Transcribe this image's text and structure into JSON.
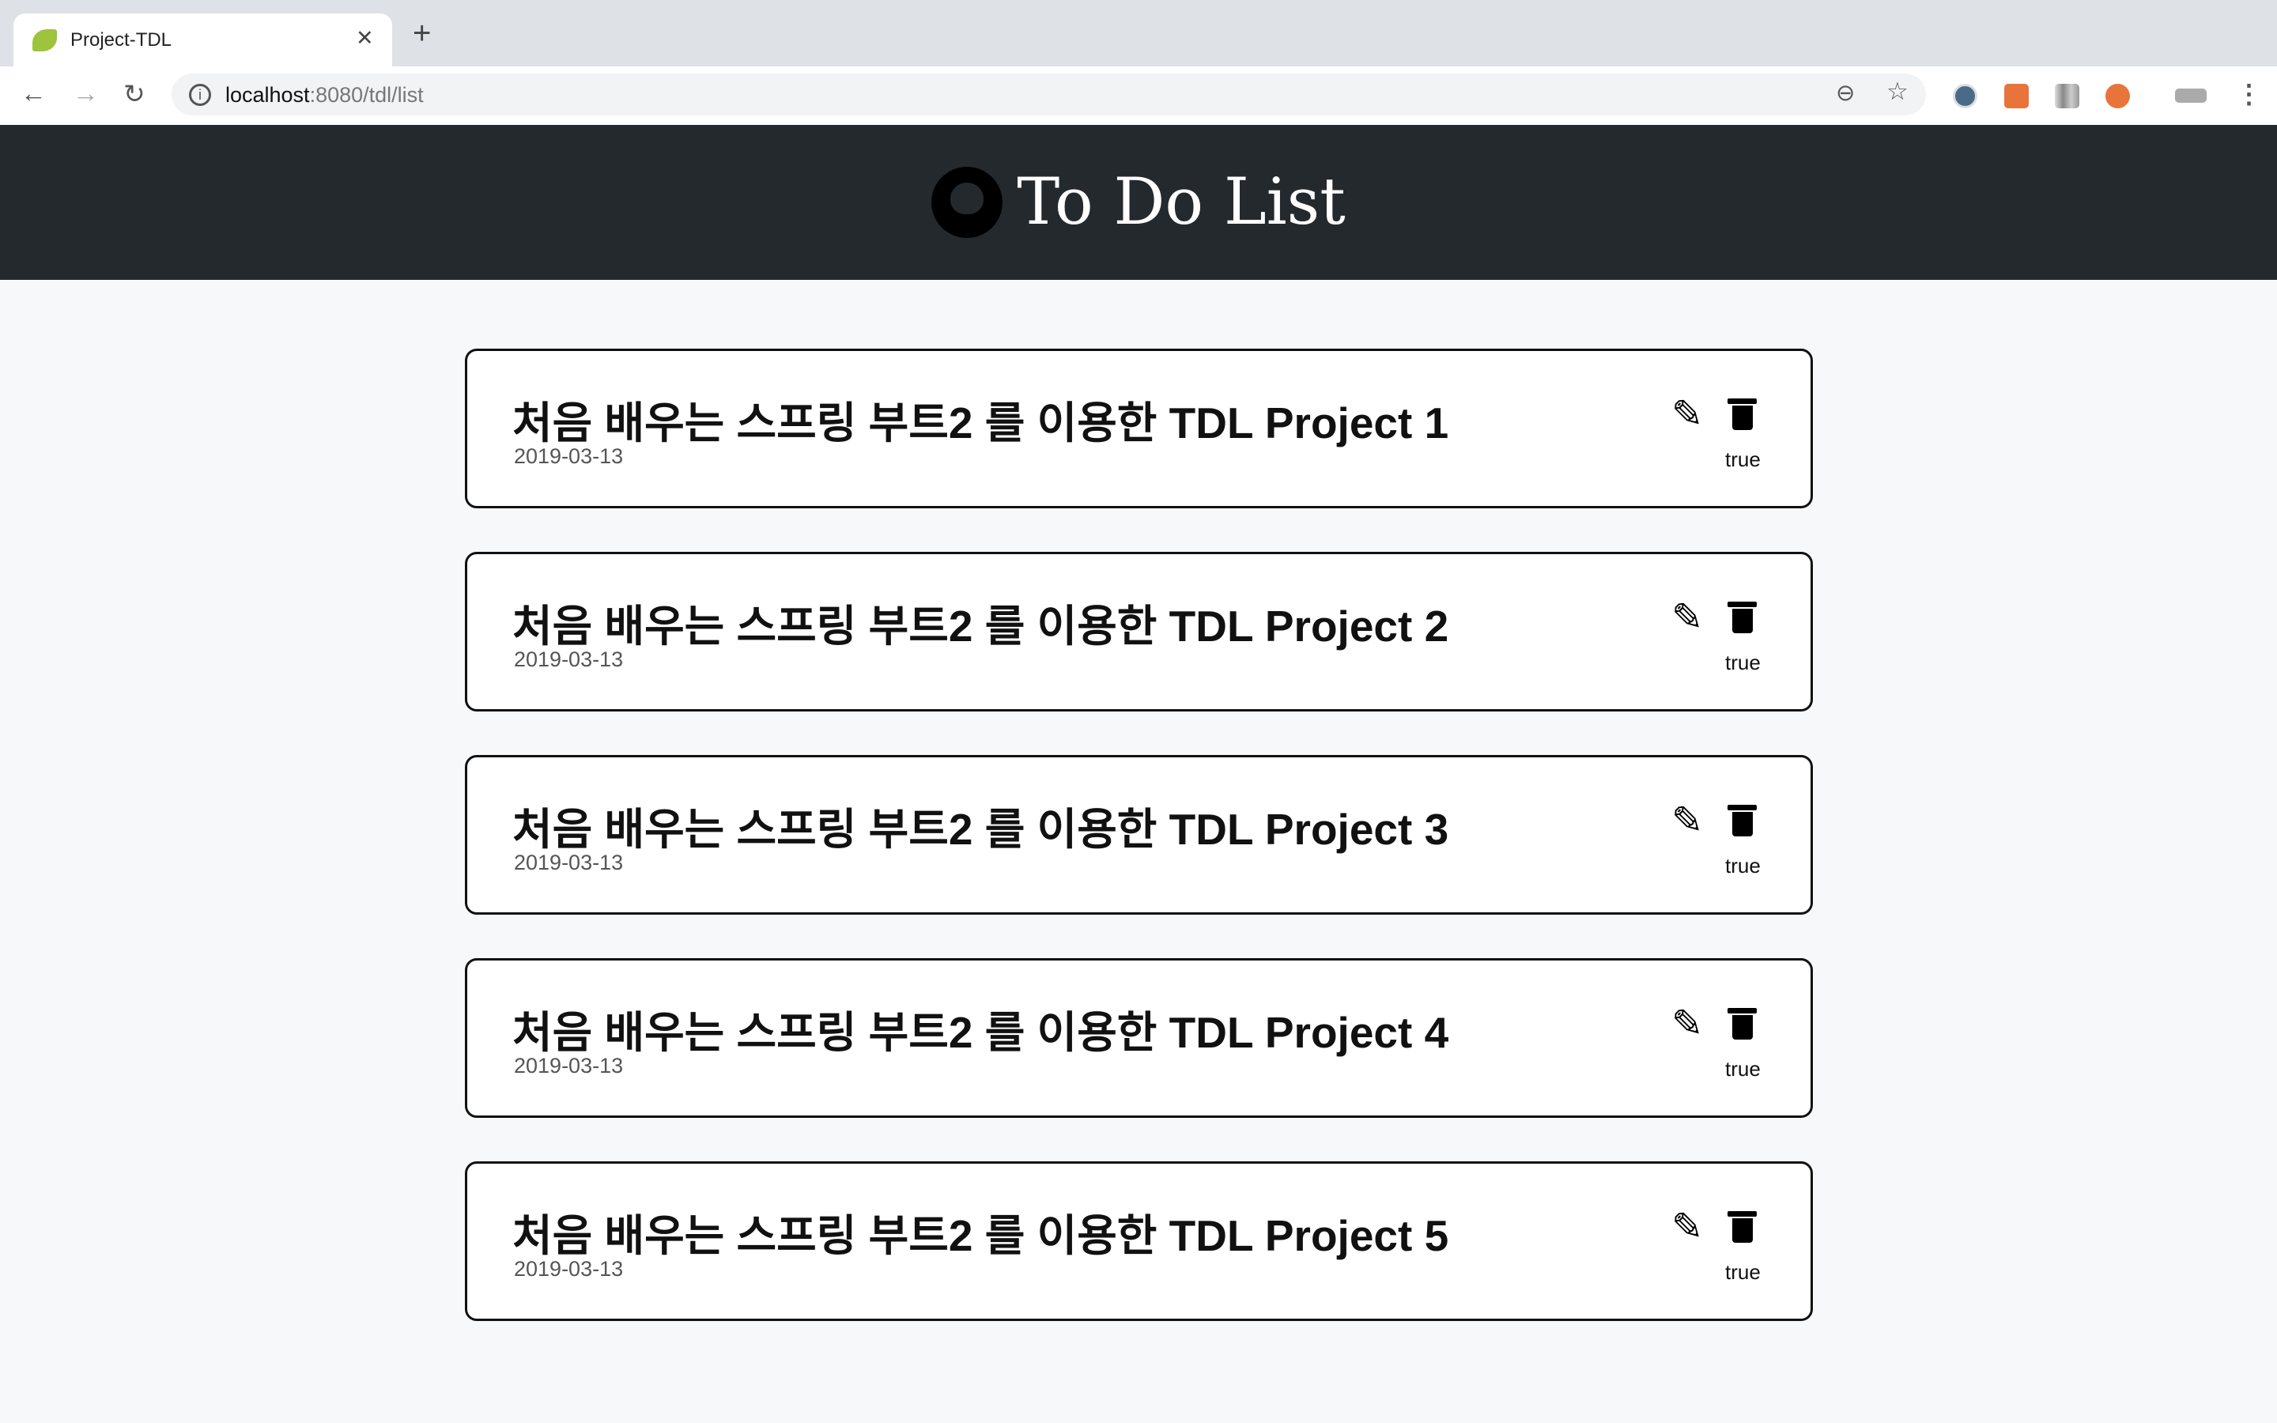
{
  "browser": {
    "tab_title": "Project-TDL",
    "url_host": "localhost",
    "url_path": ":8080/tdl/list"
  },
  "header": {
    "title": "To Do List"
  },
  "todos": [
    {
      "title": "처음 배우는 스프링 부트2 를 이용한 TDL Project 1",
      "date": "2019-03-13",
      "status": "true"
    },
    {
      "title": "처음 배우는 스프링 부트2 를 이용한 TDL Project 2",
      "date": "2019-03-13",
      "status": "true"
    },
    {
      "title": "처음 배우는 스프링 부트2 를 이용한 TDL Project 3",
      "date": "2019-03-13",
      "status": "true"
    },
    {
      "title": "처음 배우는 스프링 부트2 를 이용한 TDL Project 4",
      "date": "2019-03-13",
      "status": "true"
    },
    {
      "title": "처음 배우는 스프링 부트2 를 이용한 TDL Project 5",
      "date": "2019-03-13",
      "status": "true"
    }
  ]
}
